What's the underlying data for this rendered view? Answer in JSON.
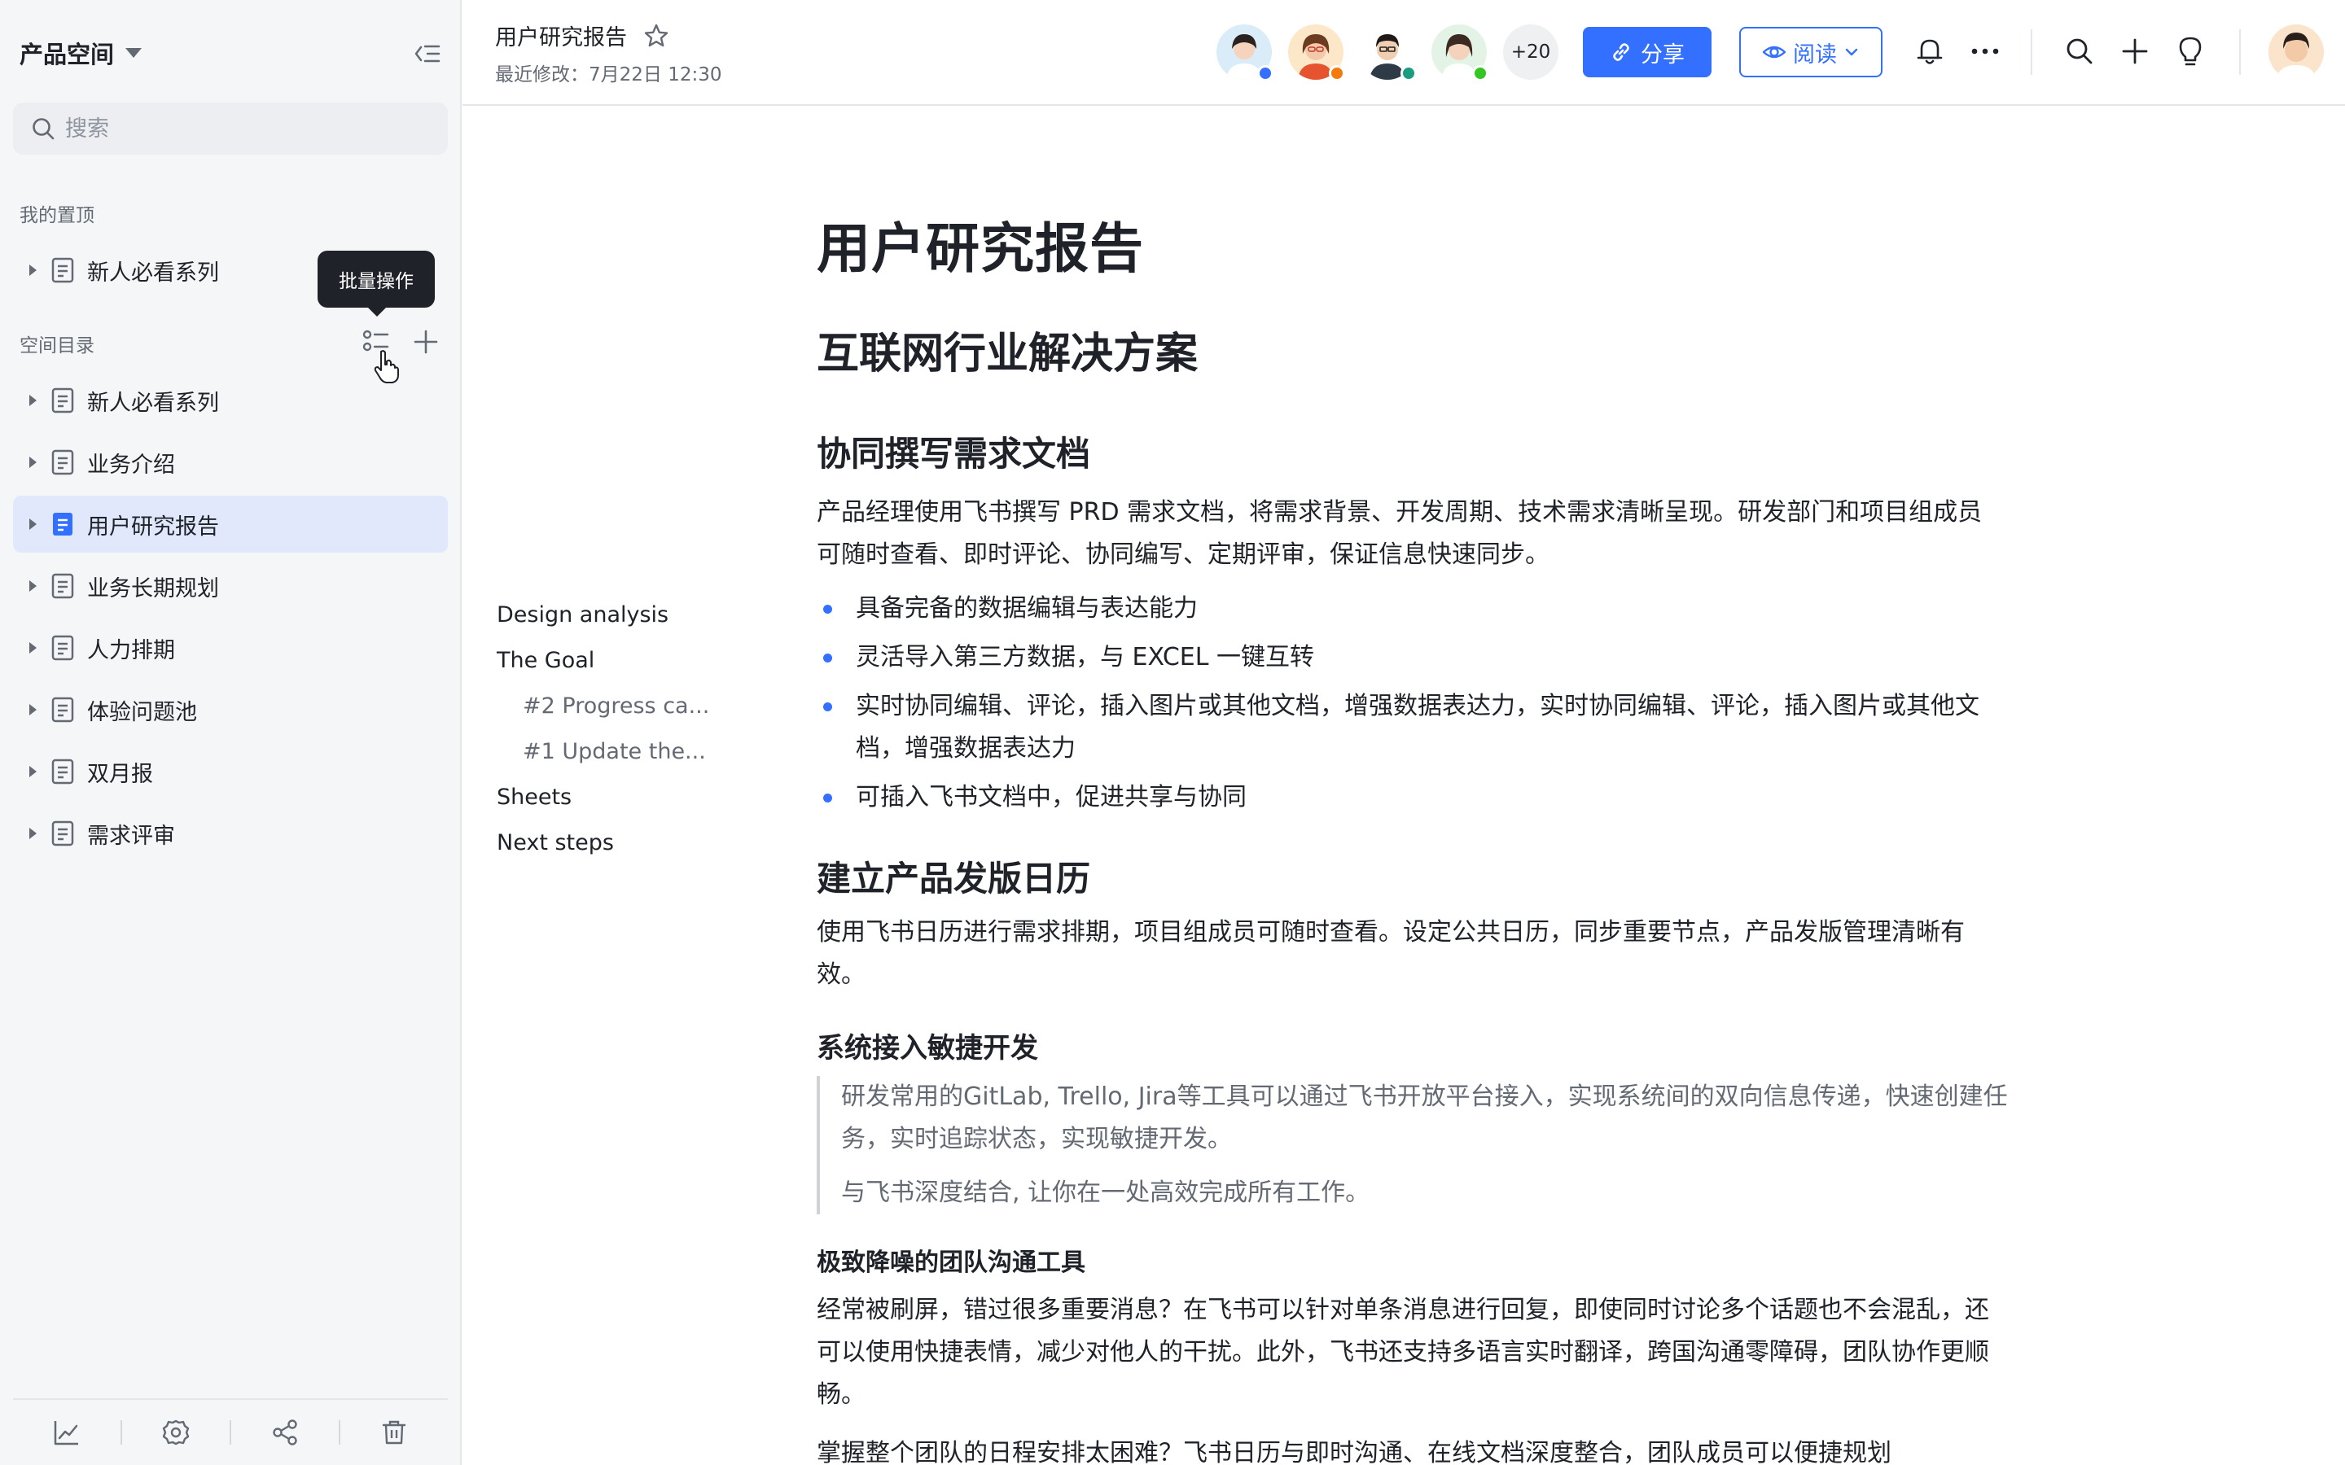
{
  "sidebar": {
    "space_title": "产品空间",
    "search_placeholder": "搜索",
    "pinned_label": "我的置顶",
    "pinned_items": [
      {
        "label": "新人必看系列"
      }
    ],
    "directory_label": "空间目录",
    "tooltip": "批量操作",
    "directory_items": [
      {
        "label": "新人必看系列"
      },
      {
        "label": "业务介绍"
      },
      {
        "label": "用户研究报告",
        "active": true
      },
      {
        "label": "业务长期规划"
      },
      {
        "label": "人力排期"
      },
      {
        "label": "体验问题池"
      },
      {
        "label": "双月报"
      },
      {
        "label": "需求评审"
      }
    ]
  },
  "header": {
    "doc_name": "用户研究报告",
    "last_modified": "最近修改：7月22日 12:30",
    "collaborators_more": "+20",
    "share_label": "分享",
    "read_label": "阅读"
  },
  "outline": {
    "items": [
      {
        "label": "Design analysis"
      },
      {
        "label": "The Goal"
      },
      {
        "label": "#2 Progress ca..."
      },
      {
        "label": "#1 Update the..."
      },
      {
        "label": "Sheets"
      },
      {
        "label": "Next steps"
      }
    ]
  },
  "document": {
    "title": "用户研究报告",
    "h2": "互联网行业解决方案",
    "section1": {
      "heading": "协同撰写需求文档",
      "para": "产品经理使用飞书撰写 PRD 需求文档，将需求背景、开发周期、技术需求清晰呈现。研发部门和项目组成员可随时查看、即时评论、协同编写、定期评审，保证信息快速同步。",
      "bullets": [
        "具备完备的数据编辑与表达能力",
        "灵活导入第三方数据，与 EXCEL 一键互转",
        "实时协同编辑、评论，插入图片或其他文档，增强数据表达力，实时协同编辑、评论，插入图片或其他文档，增强数据表达力",
        "可插入飞书文档中，促进共享与协同"
      ]
    },
    "section2": {
      "heading": "建立产品发版日历",
      "para": "使用飞书日历进行需求排期，项目组成员可随时查看。设定公共日历，同步重要节点，产品发版管理清晰有效。"
    },
    "section3": {
      "heading": "系统接入敏捷开发",
      "quote1": "研发常用的GitLab, Trello, Jira等工具可以通过飞书开放平台接入，实现系统间的双向信息传递，快速创建任务，实时追踪状态，实现敏捷开发。",
      "quote2": "与飞书深度结合, 让你在一处高效完成所有工作。"
    },
    "section4": {
      "heading": "极致降噪的团队沟通工具",
      "para1": "经常被刷屏，错过很多重要消息？在飞书可以针对单条消息进行回复，即使同时讨论多个话题也不会混乱，还可以使用快捷表情，减少对他人的干扰。此外，飞书还支持多语言实时翻译，跨国沟通零障碍，团队协作更顺畅。",
      "para2": "掌握整个团队的日程安排太困难？飞书日历与即时沟通、在线文档深度整合，团队成员可以便捷规划"
    }
  },
  "colors": {
    "accent": "#3370ff",
    "sidebar_bg": "#f5f6f7",
    "active_item_bg": "#e1e8fb",
    "status_blue": "#3370ff",
    "status_orange": "#f57a0c",
    "status_teal": "#1a9c80",
    "status_green": "#34c724"
  }
}
